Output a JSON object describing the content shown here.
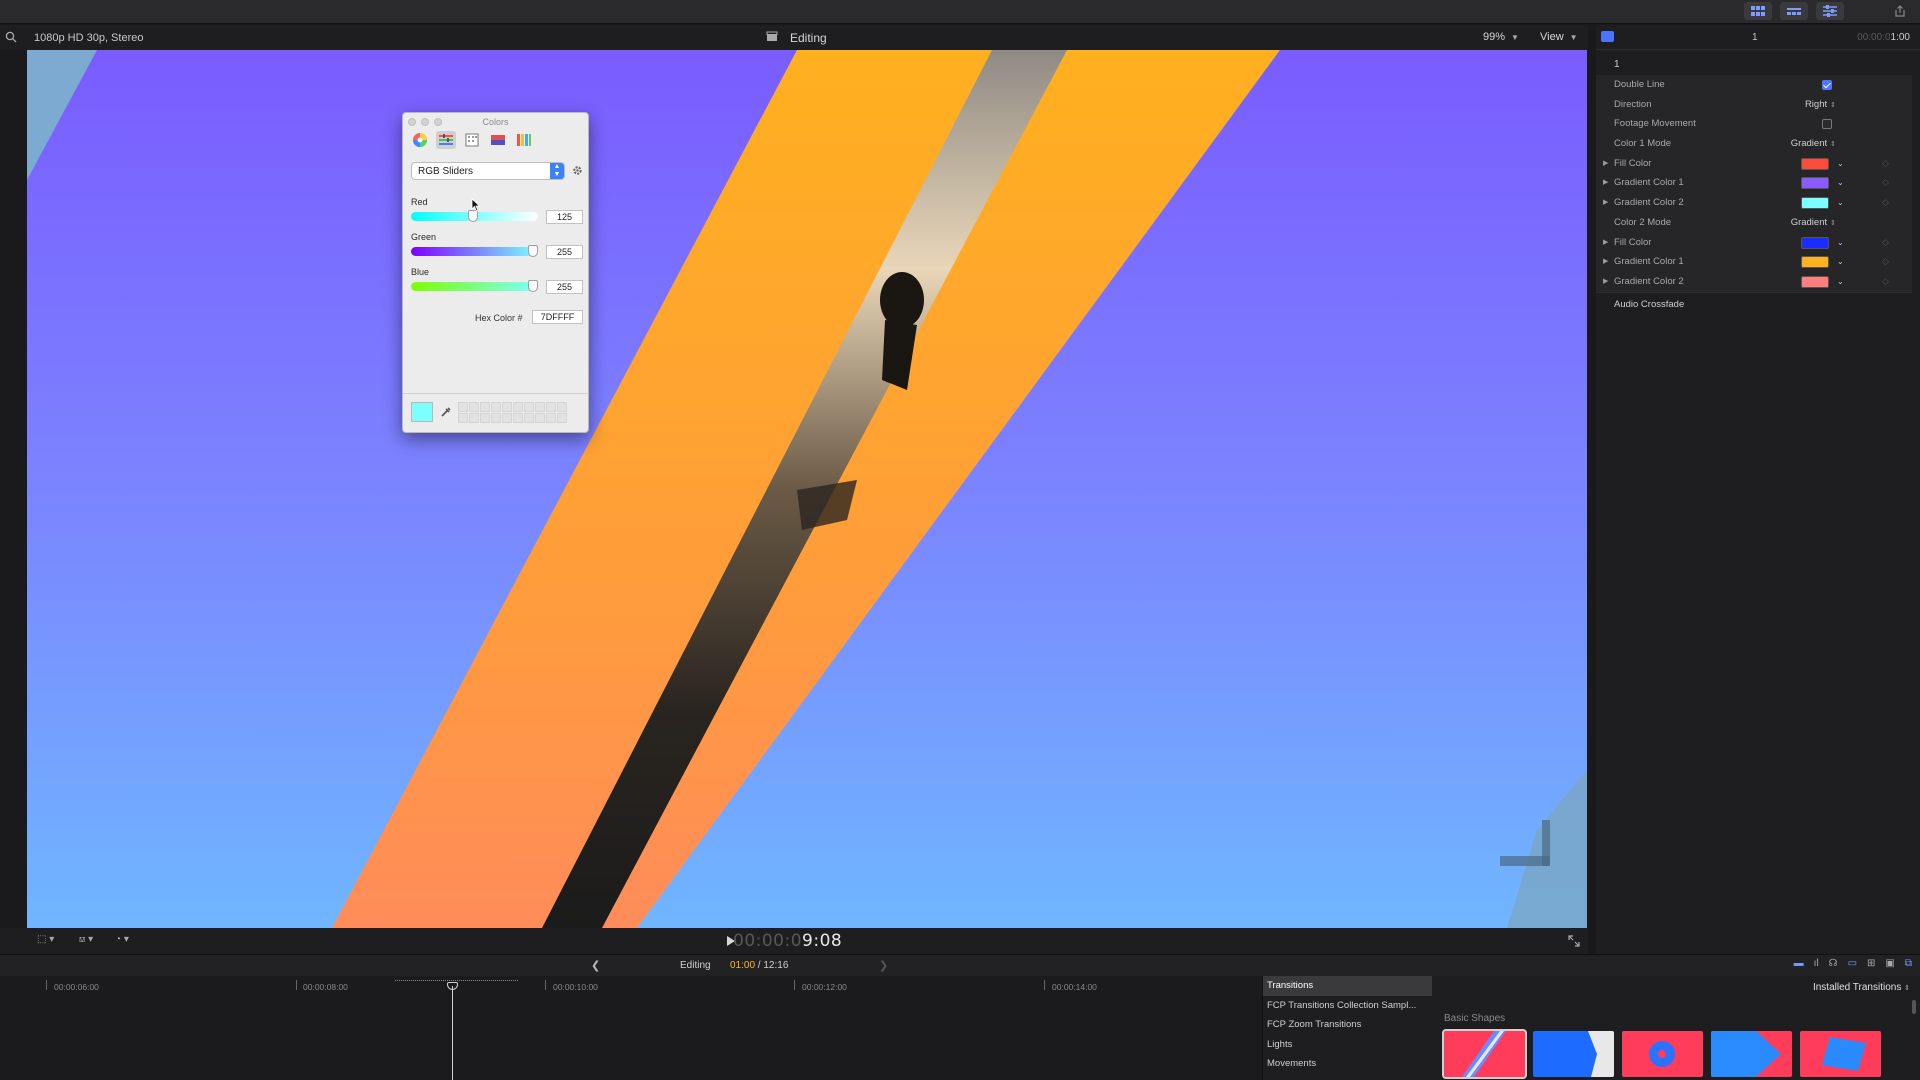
{
  "viewer_header": {
    "format": "1080p HD 30p, Stereo",
    "project": "Editing",
    "zoom": "99%",
    "view": "View"
  },
  "colors_panel": {
    "title": "Colors",
    "mode": "RGB Sliders",
    "channels": [
      {
        "label": "Red",
        "value": "125",
        "level": 0.49
      },
      {
        "label": "Green",
        "value": "255",
        "level": 1.0
      },
      {
        "label": "Blue",
        "value": "255",
        "level": 1.0
      }
    ],
    "hex_label": "Hex Color #",
    "hex_value": "7DFFFF",
    "current_color": "#7DFFFF"
  },
  "inspector": {
    "number": "1",
    "duration_prefix": "00:00:0",
    "duration_main": "1:00",
    "title": "1",
    "rows": [
      {
        "label": "Double Line",
        "type": "checkbox",
        "checked": true
      },
      {
        "label": "Direction",
        "type": "value",
        "value": "Right"
      },
      {
        "label": "Footage Movement",
        "type": "checkbox",
        "checked": false
      },
      {
        "label": "Color 1 Mode",
        "type": "value",
        "value": "Gradient"
      },
      {
        "label": "Fill Color",
        "type": "color",
        "color": "#ff4b3a"
      },
      {
        "label": "Gradient Color 1",
        "type": "color",
        "color": "#8b5bff"
      },
      {
        "label": "Gradient Color 2",
        "type": "color",
        "color": "#7dffff"
      },
      {
        "label": "Color 2 Mode",
        "type": "value",
        "value": "Gradient"
      },
      {
        "label": "Fill Color",
        "type": "color",
        "color": "#1b2cff"
      },
      {
        "label": "Gradient Color 1",
        "type": "color",
        "color": "#ffb21f"
      },
      {
        "label": "Gradient Color 2",
        "type": "color",
        "color": "#ff7d7d"
      }
    ],
    "audio": "Audio Crossfade"
  },
  "viewer_controls": {
    "timecode_dim": "00:00:0",
    "timecode_main": "9:08"
  },
  "timeline_bar": {
    "project": "Editing",
    "position": "01:00",
    "total": " / 12:16"
  },
  "timeline": {
    "ruler": [
      "00:00:06:00",
      "00:00:08:00",
      "00:00:10:00",
      "00:00:12:00",
      "00:00:14:00"
    ]
  },
  "browser": {
    "items": [
      "Transitions",
      "FCP Transitions Collection Sampl...",
      "FCP Zoom Transitions",
      "Lights",
      "Movements"
    ],
    "installed": "Installed Transitions",
    "group": "Basic Shapes"
  }
}
